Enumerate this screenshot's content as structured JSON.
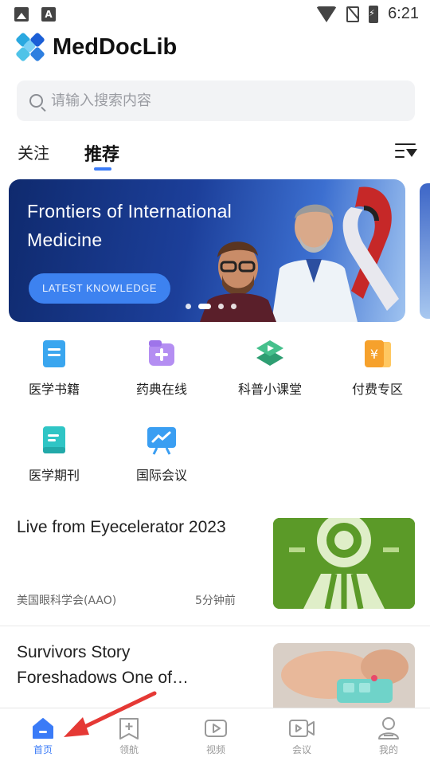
{
  "status_bar": {
    "time": "6:21"
  },
  "app": {
    "title": "MedDocLib"
  },
  "search": {
    "placeholder": "请输入搜索内容"
  },
  "tabs": [
    {
      "label": "关注",
      "active": false
    },
    {
      "label": "推荐",
      "active": true
    }
  ],
  "banner": {
    "title": "Frontiers of International Medicine",
    "button_label": "LATEST KNOWLEDGE",
    "page_count": 4,
    "active_page": 2
  },
  "categories": [
    {
      "label": "医学书籍",
      "icon": "book-icon"
    },
    {
      "label": "药典在线",
      "icon": "plus-folder-icon"
    },
    {
      "label": "科普小课堂",
      "icon": "play-stack-icon"
    },
    {
      "label": "付费专区",
      "icon": "yuan-icon"
    },
    {
      "label": "医学期刊",
      "icon": "journal-icon"
    },
    {
      "label": "国际会议",
      "icon": "presentation-icon"
    }
  ],
  "articles": [
    {
      "title": "Live from Eyecelerator 2023",
      "source": "美国眼科学会(AAO)",
      "time": "5分钟前"
    },
    {
      "title": "Survivors Story Foreshadows One of…"
    }
  ],
  "bottom_nav": [
    {
      "label": "首页",
      "icon": "home-icon",
      "active": true
    },
    {
      "label": "领航",
      "icon": "bookmark-plus-icon",
      "active": false
    },
    {
      "label": "视频",
      "icon": "video-icon",
      "active": false
    },
    {
      "label": "会议",
      "icon": "camera-icon",
      "active": false
    },
    {
      "label": "我的",
      "icon": "user-icon",
      "active": false
    }
  ],
  "colors": {
    "accent": "#3a7bf7",
    "annotation": "#e53935"
  }
}
